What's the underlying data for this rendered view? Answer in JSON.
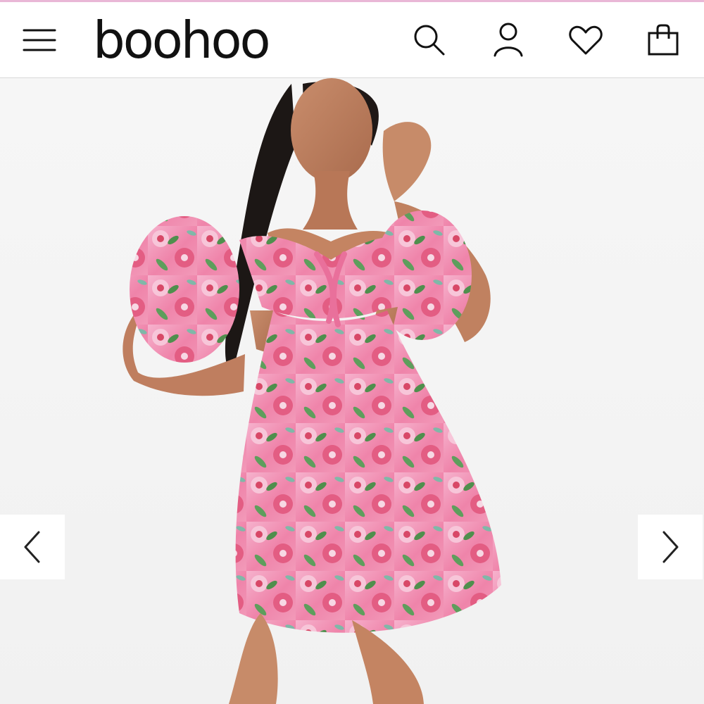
{
  "header": {
    "logo_text": "boohoo",
    "icons": {
      "menu": "hamburger-menu-icon",
      "search": "search-icon",
      "account": "user-icon",
      "wishlist": "heart-icon",
      "bag": "shopping-bag-icon"
    }
  },
  "gallery": {
    "image": "product-photo-floral-mini-dress",
    "prev_icon": "chevron-left-icon",
    "next_icon": "chevron-right-icon"
  },
  "colors": {
    "top_accent": "#e9b7d6",
    "dress_pink": "#f28fb5",
    "dress_red": "#d84867",
    "leaf_green": "#4f8f4d",
    "background": "#f4f4f4"
  }
}
